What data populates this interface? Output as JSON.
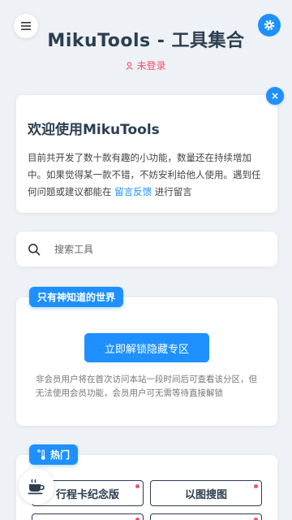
{
  "header": {
    "title": "MikuTools - 工具集合",
    "login_status": "未登录"
  },
  "welcome": {
    "heading": "欢迎使用MikuTools",
    "text_before": "目前共开发了数十款有趣的小功能，数量还在持续增加中。如果觉得某一款不错，不妨安利给他人使用。遇到任何问题或建议都能在 ",
    "feedback_link": "留言反馈",
    "text_after": " 进行留言",
    "close_label": "×"
  },
  "search": {
    "placeholder": "搜索工具",
    "value": ""
  },
  "secret": {
    "badge": "只有神知道的世界",
    "unlock_button": "立即解锁隐藏专区",
    "note": "非会员用户将在首次访问本站一段时间后可查看该分区，但无法使用会员功能，会员用户可无需等待直接解锁"
  },
  "hot": {
    "badge": "热门",
    "tools": [
      "行程卡纪念版",
      "以图搜图",
      "",
      ""
    ]
  },
  "colors": {
    "accent": "#1e90ff",
    "alert": "#f0506e",
    "text": "#2c3e50"
  },
  "icons": {
    "menu": "menu-icon",
    "settings": "gear-icon",
    "user": "user-icon",
    "close": "close-icon",
    "search": "search-icon",
    "hot": "thermometer-icon",
    "coffee": "coffee-icon"
  }
}
